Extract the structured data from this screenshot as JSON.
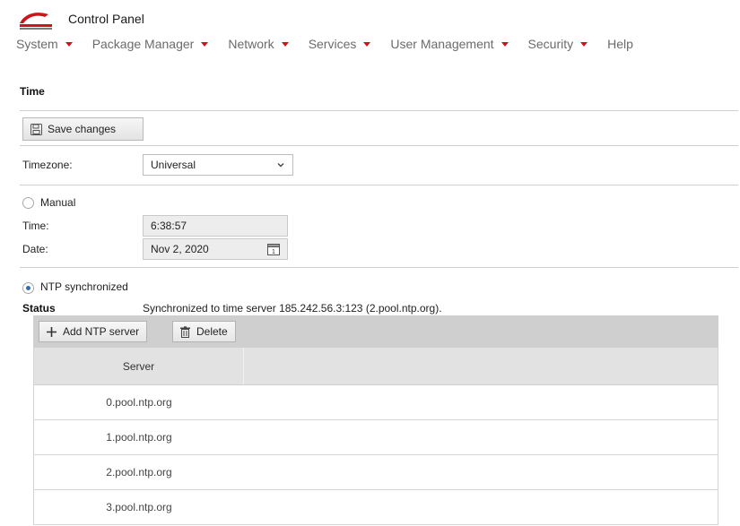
{
  "app": {
    "title": "Control Panel"
  },
  "menu": [
    {
      "label": "System",
      "has_dropdown": true
    },
    {
      "label": "Package Manager",
      "has_dropdown": true
    },
    {
      "label": "Network",
      "has_dropdown": true
    },
    {
      "label": "Services",
      "has_dropdown": true
    },
    {
      "label": "User Management",
      "has_dropdown": true
    },
    {
      "label": "Security",
      "has_dropdown": true
    },
    {
      "label": "Help",
      "has_dropdown": false
    }
  ],
  "page": {
    "title": "Time",
    "save_label": "Save changes"
  },
  "timezone": {
    "label": "Timezone:",
    "value": "Universal"
  },
  "manual": {
    "label": "Manual",
    "checked": false,
    "time_label": "Time:",
    "time_value": "6:38:57",
    "date_label": "Date:",
    "date_value": "Nov 2, 2020"
  },
  "ntp": {
    "label": "NTP synchronized",
    "checked": true,
    "status_label": "Status",
    "status_text": "Synchronized to time server 185.242.56.3:123 (2.pool.ntp.org).",
    "add_label": "Add NTP server",
    "delete_label": "Delete",
    "column_header": "Server",
    "servers": [
      "0.pool.ntp.org",
      "1.pool.ntp.org",
      "2.pool.ntp.org",
      "3.pool.ntp.org"
    ]
  },
  "colors": {
    "accent_red": "#d0121b",
    "radio_blue": "#2e6db4"
  },
  "icons": [
    "logo",
    "chevron-down-icon",
    "floppy-disk-icon",
    "calendar-icon",
    "plus-icon",
    "trash-icon"
  ]
}
